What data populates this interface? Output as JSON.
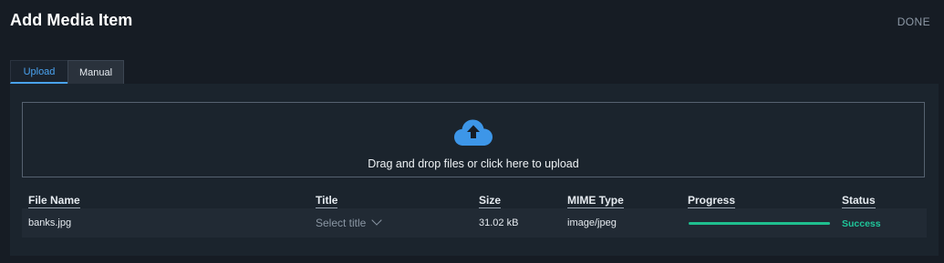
{
  "header": {
    "title": "Add Media Item",
    "done_label": "DONE"
  },
  "tabs": [
    {
      "label": "Upload",
      "active": true
    },
    {
      "label": "Manual",
      "active": false
    }
  ],
  "dropzone": {
    "icon": "cloud-upload-icon",
    "text": "Drag and drop files or click here to upload"
  },
  "table": {
    "columns": [
      "File Name",
      "Title",
      "Size",
      "MIME Type",
      "Progress",
      "Status"
    ],
    "rows": [
      {
        "file_name": "banks.jpg",
        "title_placeholder": "Select title",
        "size": "31.02 kB",
        "mime_type": "image/jpeg",
        "progress": 1.0,
        "status": "Success"
      }
    ]
  },
  "colors": {
    "accent": "#4aa3f0",
    "success": "#1fc69a",
    "background": "#161c24"
  }
}
